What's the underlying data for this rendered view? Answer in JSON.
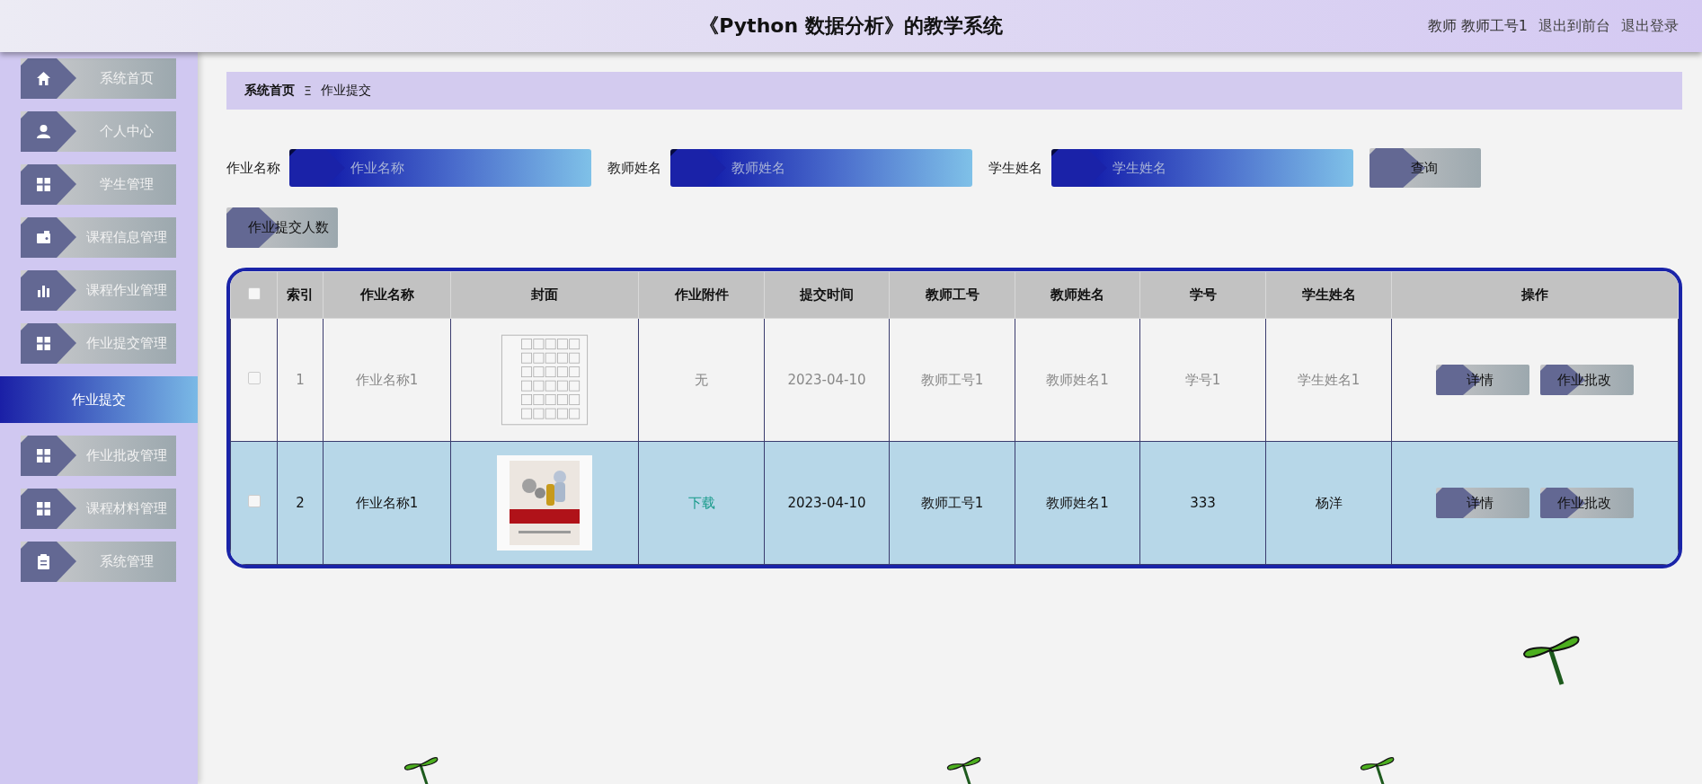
{
  "header": {
    "title": "《Python 数据分析》的教学系统",
    "user": "教师 教师工号1",
    "links": [
      "退出到前台",
      "退出登录"
    ]
  },
  "sidebar": {
    "items": [
      {
        "label": "系统首页",
        "selected": false
      },
      {
        "label": "个人中心",
        "selected": false
      },
      {
        "label": "学生管理",
        "selected": false
      },
      {
        "label": "课程信息管理",
        "selected": false
      },
      {
        "label": "课程作业管理",
        "selected": false
      },
      {
        "label": "作业提交管理",
        "selected": false,
        "children": [
          {
            "label": "作业提交",
            "selected": true
          }
        ]
      },
      {
        "label": "作业批改管理",
        "selected": false
      },
      {
        "label": "课程材料管理",
        "selected": false
      },
      {
        "label": "系统管理",
        "selected": false
      }
    ]
  },
  "breadcrumb": {
    "items": [
      "系统首页",
      "作业提交"
    ],
    "separator": "Ξ"
  },
  "search": {
    "fields": [
      {
        "label": "作业名称",
        "placeholder": "作业名称"
      },
      {
        "label": "教师姓名",
        "placeholder": "教师姓名"
      },
      {
        "label": "学生姓名",
        "placeholder": "学生姓名"
      }
    ],
    "button": "查询"
  },
  "actions": [
    "作业提交人数"
  ],
  "table": {
    "all_checked": false,
    "columns": [
      "索引",
      "作业名称",
      "封面",
      "作业附件",
      "提交时间",
      "教师工号",
      "教师姓名",
      "学号",
      "学生姓名",
      "操作"
    ],
    "rows": [
      {
        "selected": false,
        "checked": false,
        "cells": [
          "1",
          "作业名称1",
          {
            "kind": "picture"
          },
          {
            "kind": "text",
            "text": "无"
          },
          "2023-04-10",
          "教师工号1",
          "教师姓名1",
          "学号1",
          "学生姓名1"
        ],
        "buttons": [
          "详情",
          "作业批改"
        ]
      },
      {
        "selected": true,
        "checked": false,
        "cells": [
          "2",
          "作业名称1",
          {
            "kind": "picture"
          },
          {
            "kind": "link",
            "text": "下载"
          },
          "2023-04-10",
          "教师工号1",
          "教师姓名1",
          "333",
          "杨洋"
        ],
        "buttons": [
          "详情",
          "作业批改"
        ]
      }
    ]
  }
}
